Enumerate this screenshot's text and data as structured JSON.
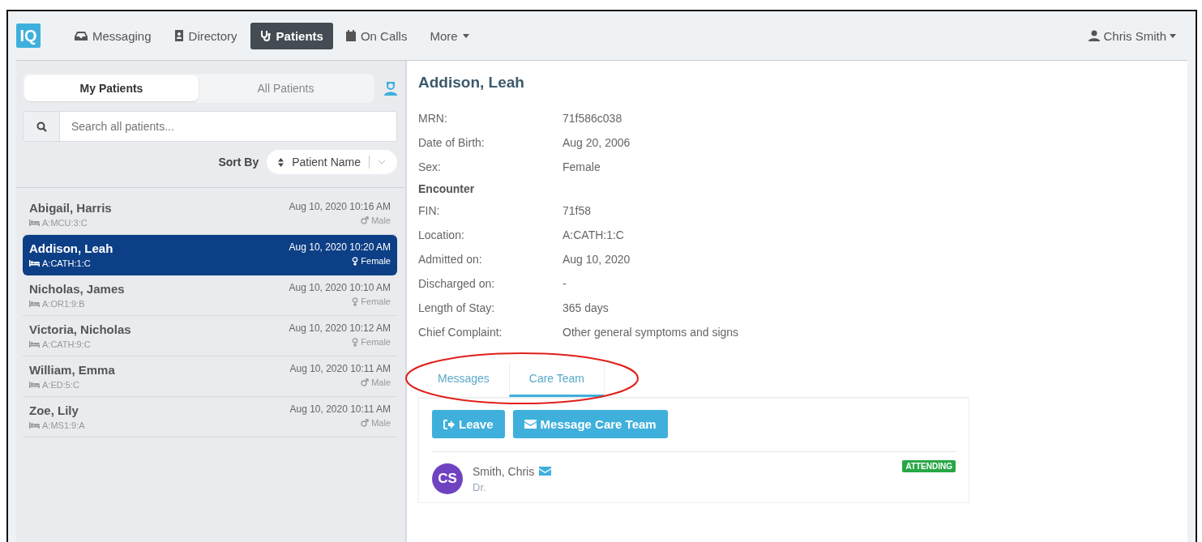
{
  "nav": {
    "logo": "IQ",
    "items": [
      {
        "label": "Messaging",
        "kind": "inbox",
        "selected": false
      },
      {
        "label": "Directory",
        "kind": "book",
        "selected": false
      },
      {
        "label": "Patients",
        "kind": "stethoscope",
        "selected": true
      },
      {
        "label": "On Calls",
        "kind": "calendar",
        "selected": false
      },
      {
        "label": "More",
        "kind": "dropdown",
        "selected": false
      }
    ],
    "user": "Chris Smith"
  },
  "patient_tabs": [
    {
      "label": "My Patients",
      "selected": true
    },
    {
      "label": "All Patients",
      "selected": false
    }
  ],
  "search": {
    "placeholder": "Search all patients..."
  },
  "sort": {
    "label": "Sort By",
    "value": "Patient Name"
  },
  "patients": [
    {
      "name": "Abigail, Harris",
      "location": "A:MCU:3:C",
      "datetime": "Aug 10, 2020 10:16 AM",
      "sex": "Male",
      "kind": "male",
      "selected": false
    },
    {
      "name": "Addison, Leah",
      "location": "A:CATH:1:C",
      "datetime": "Aug 10, 2020 10:20 AM",
      "sex": "Female",
      "kind": "female",
      "selected": true
    },
    {
      "name": "Nicholas, James",
      "location": "A:OR1:9:B",
      "datetime": "Aug 10, 2020 10:10 AM",
      "sex": "Female",
      "kind": "female",
      "selected": false
    },
    {
      "name": "Victoria, Nicholas",
      "location": "A:CATH:9:C",
      "datetime": "Aug 10, 2020 10:12 AM",
      "sex": "Female",
      "kind": "female",
      "selected": false
    },
    {
      "name": "William, Emma",
      "location": "A:ED:5:C",
      "datetime": "Aug 10, 2020 10:11 AM",
      "sex": "Male",
      "kind": "male",
      "selected": false
    },
    {
      "name": "Zoe, Lily",
      "location": "A:MS1:9:A",
      "datetime": "Aug 10, 2020 10:11 AM",
      "sex": "Male",
      "kind": "male",
      "selected": false
    }
  ],
  "detail": {
    "title": "Addison, Leah",
    "rows": [
      {
        "kind": "field",
        "label": "MRN:",
        "value": "71f586c038"
      },
      {
        "kind": "field",
        "label": "Date of Birth:",
        "value": "Aug 20, 2006"
      },
      {
        "kind": "field",
        "label": "Sex:",
        "value": "Female"
      },
      {
        "kind": "heading",
        "label": "Encounter"
      },
      {
        "kind": "field",
        "label": "FIN:",
        "value": "71f58"
      },
      {
        "kind": "field",
        "label": "Location:",
        "value": "A:CATH:1:C"
      },
      {
        "kind": "field",
        "label": "Admitted on:",
        "value": "Aug 10, 2020"
      },
      {
        "kind": "field",
        "label": "Discharged on:",
        "value": "-"
      },
      {
        "kind": "field",
        "label": "Length of Stay:",
        "value": "365 days"
      },
      {
        "kind": "field",
        "label": "Chief Complaint:",
        "value": "Other general symptoms and signs"
      }
    ]
  },
  "detail_tabs": [
    {
      "label": "Messages",
      "selected": false
    },
    {
      "label": "Care Team",
      "selected": true
    }
  ],
  "buttons": [
    {
      "label": "Leave",
      "kind": "leave"
    },
    {
      "label": "Message Care Team",
      "kind": "message"
    }
  ],
  "care_team": [
    {
      "initials": "CS",
      "name": "Smith, Chris",
      "title": "Dr.",
      "role": "ATTENDING",
      "color": "#6f42c1"
    }
  ]
}
